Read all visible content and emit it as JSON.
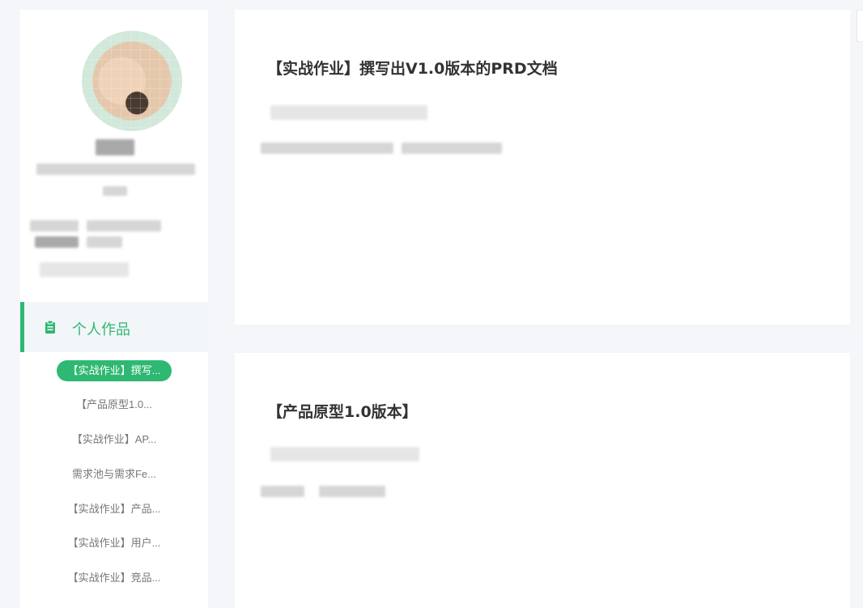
{
  "sidebar": {
    "section_title": "个人作品",
    "section_icon": "clipboard-icon",
    "accent_color": "#2eb872",
    "items": [
      {
        "label": "【实战作业】撰写...",
        "active": true
      },
      {
        "label": "【产品原型1.0..."
      },
      {
        "label": "【实战作业】AP..."
      },
      {
        "label": "需求池与需求Fe..."
      },
      {
        "label": "【实战作业】产品..."
      },
      {
        "label": "【实战作业】用户..."
      },
      {
        "label": "【实战作业】竞品..."
      }
    ]
  },
  "works": [
    {
      "title": "【实战作业】撰写出V1.0版本的PRD文档"
    },
    {
      "title": "【产品原型1.0版本】"
    }
  ]
}
